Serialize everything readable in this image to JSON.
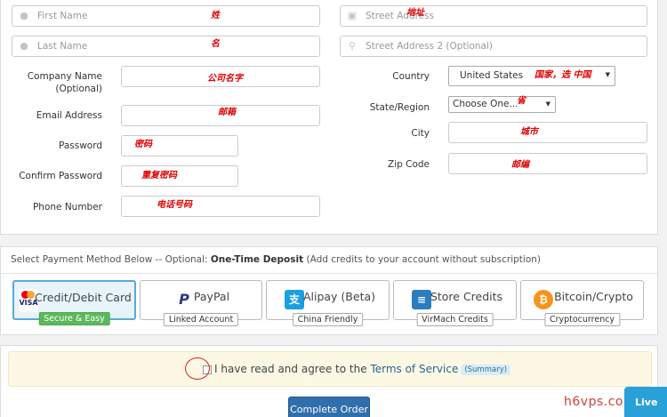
{
  "form": {
    "first_name": {
      "placeholder": "First Name",
      "annotation": "姓"
    },
    "last_name": {
      "placeholder": "Last Name",
      "annotation": "名"
    },
    "street1": {
      "placeholder": "Street Address",
      "annotation": "地址"
    },
    "street2": {
      "placeholder": "Street Address 2 (Optional)"
    },
    "company": {
      "label_line1": "Company Name",
      "label_line2": "(Optional)",
      "annotation": "公司名字"
    },
    "email": {
      "label": "Email Address",
      "annotation": "邮箱"
    },
    "password": {
      "label": "Password",
      "annotation": "密码"
    },
    "confirm_password": {
      "label": "Confirm Password",
      "annotation": "重复密码"
    },
    "phone": {
      "label": "Phone Number",
      "annotation": "电话号码"
    },
    "country": {
      "label": "Country",
      "value": "United States",
      "annotation": "国家，选 中国"
    },
    "state": {
      "label": "State/Region",
      "value": "Choose One...",
      "annotation": "省"
    },
    "city": {
      "label": "City",
      "annotation": "城市"
    },
    "zip": {
      "label": "Zip Code",
      "annotation": "邮编"
    }
  },
  "payment": {
    "header_prefix": "Select Payment Method Below -- Optional: ",
    "header_bold": "One-Time Deposit",
    "header_suffix": " (Add credits to your account without subscription)",
    "methods": [
      {
        "label": "Credit/Debit Card",
        "badge": "Secure & Easy",
        "icon": "credit-card-icon",
        "logo": "VISA"
      },
      {
        "label": "PayPal",
        "badge": "Linked Account",
        "icon": "paypal-icon",
        "logo": "P"
      },
      {
        "label": "Alipay (Beta)",
        "badge": "China Friendly",
        "icon": "alipay-icon",
        "logo": "支"
      },
      {
        "label": "Store Credits",
        "badge": "VirMach Credits",
        "icon": "server-icon",
        "logo": "≡"
      },
      {
        "label": "Bitcoin/Crypto",
        "badge": "Cryptocurrency",
        "icon": "bitcoin-icon",
        "logo": "₿"
      }
    ]
  },
  "tos": {
    "text": "I have read and agree to the ",
    "link": "Terms of Service",
    "summary": "(Summary)"
  },
  "complete_button": "Complete Order",
  "watermark": "h6vps.com",
  "chat_label": "Live",
  "colors": {
    "accent": "#2f6fab",
    "annotation": "#e00000",
    "badge_green": "#5cb85c"
  }
}
